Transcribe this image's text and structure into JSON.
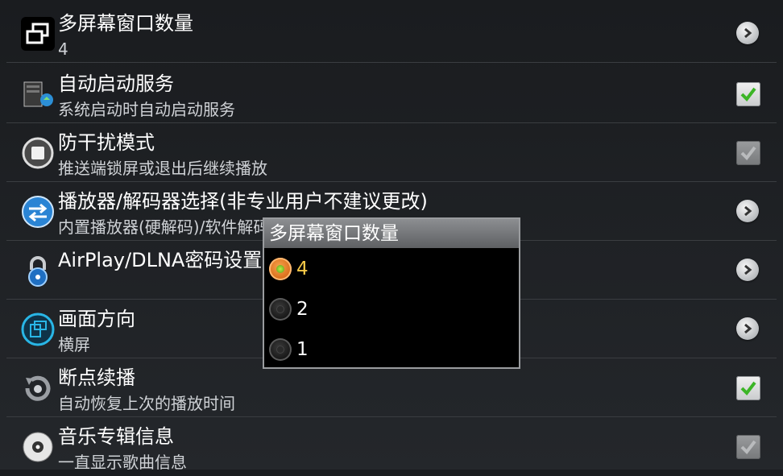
{
  "settings": [
    {
      "title": "多屏幕窗口数量",
      "summary": "4",
      "icon": "multi-window-icon",
      "widget": "chevron"
    },
    {
      "title": "自动启动服务",
      "summary": "系统启动时自动启动服务",
      "icon": "computer-service-icon",
      "widget": "checkbox",
      "checked": true
    },
    {
      "title": "防干扰模式",
      "summary": "推送端锁屏或退出后继续播放",
      "icon": "stop-button-icon",
      "widget": "checkbox",
      "checked": false
    },
    {
      "title": "播放器/解码器选择(非专业用户不建议更改)",
      "summary": "内置播放器(硬解码)/软件解码",
      "icon": "swap-arrows-icon",
      "widget": "chevron"
    },
    {
      "title": "AirPlay/DLNA密码设置",
      "summary": "",
      "icon": "padlock-icon",
      "widget": "chevron"
    },
    {
      "title": "画面方向",
      "summary": "横屏",
      "icon": "screen-rotate-icon",
      "widget": "chevron"
    },
    {
      "title": "断点续播",
      "summary": "自动恢复上次的播放时间",
      "icon": "resume-icon",
      "widget": "checkbox",
      "checked": true
    },
    {
      "title": "音乐专辑信息",
      "summary": "一直显示歌曲信息",
      "icon": "disc-icon",
      "widget": "checkbox",
      "checked": false
    }
  ],
  "dialog": {
    "title": "多屏幕窗口数量",
    "options": [
      {
        "label": "4",
        "selected": true
      },
      {
        "label": "2",
        "selected": false
      },
      {
        "label": "1",
        "selected": false
      }
    ]
  },
  "colors": {
    "check_green": "#3cb526",
    "radio_selected": "#e07a20",
    "selected_text": "#f7c948"
  }
}
